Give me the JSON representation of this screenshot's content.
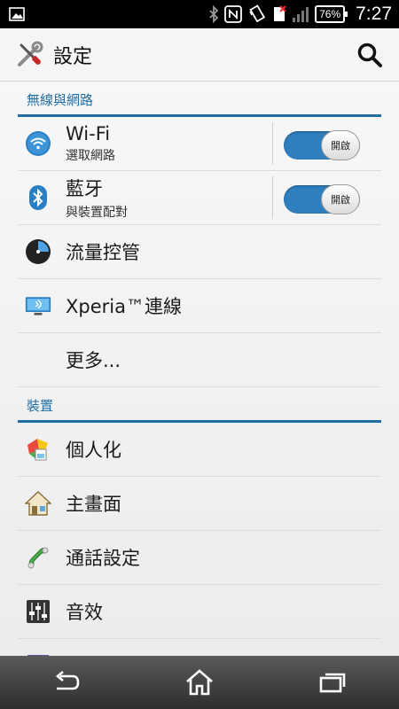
{
  "status_bar": {
    "icons": [
      "image-icon",
      "bluetooth-icon",
      "nfc-icon",
      "vibrate-icon",
      "sim-icon",
      "signal-icon",
      "battery-icon"
    ],
    "battery": "76%",
    "time": "7:27"
  },
  "app_bar": {
    "title": "設定",
    "icon": "tools-icon",
    "search_icon": "search-icon"
  },
  "sections": {
    "wireless": {
      "header": "無線與網路",
      "wifi": {
        "label": "Wi-Fi",
        "sublabel": "選取網路",
        "toggle": "開啟"
      },
      "bluetooth": {
        "label": "藍牙",
        "sublabel": "與裝置配對",
        "toggle": "開啟"
      },
      "data": {
        "label": "流量控管"
      },
      "xperia": {
        "label": "Xperia™連線"
      },
      "more": {
        "label": "更多..."
      }
    },
    "device": {
      "header": "裝置",
      "personalize": {
        "label": "個人化"
      },
      "home": {
        "label": "主畫面"
      },
      "call": {
        "label": "通話設定"
      },
      "sound": {
        "label": "音效"
      }
    }
  },
  "nav_bar": {
    "icons": [
      "back-icon",
      "home-icon",
      "recent-apps-icon"
    ]
  },
  "colors": {
    "accent": "#1f6ea6",
    "toggle_on": "#2f7fbf",
    "background": "#f2f2f2"
  }
}
